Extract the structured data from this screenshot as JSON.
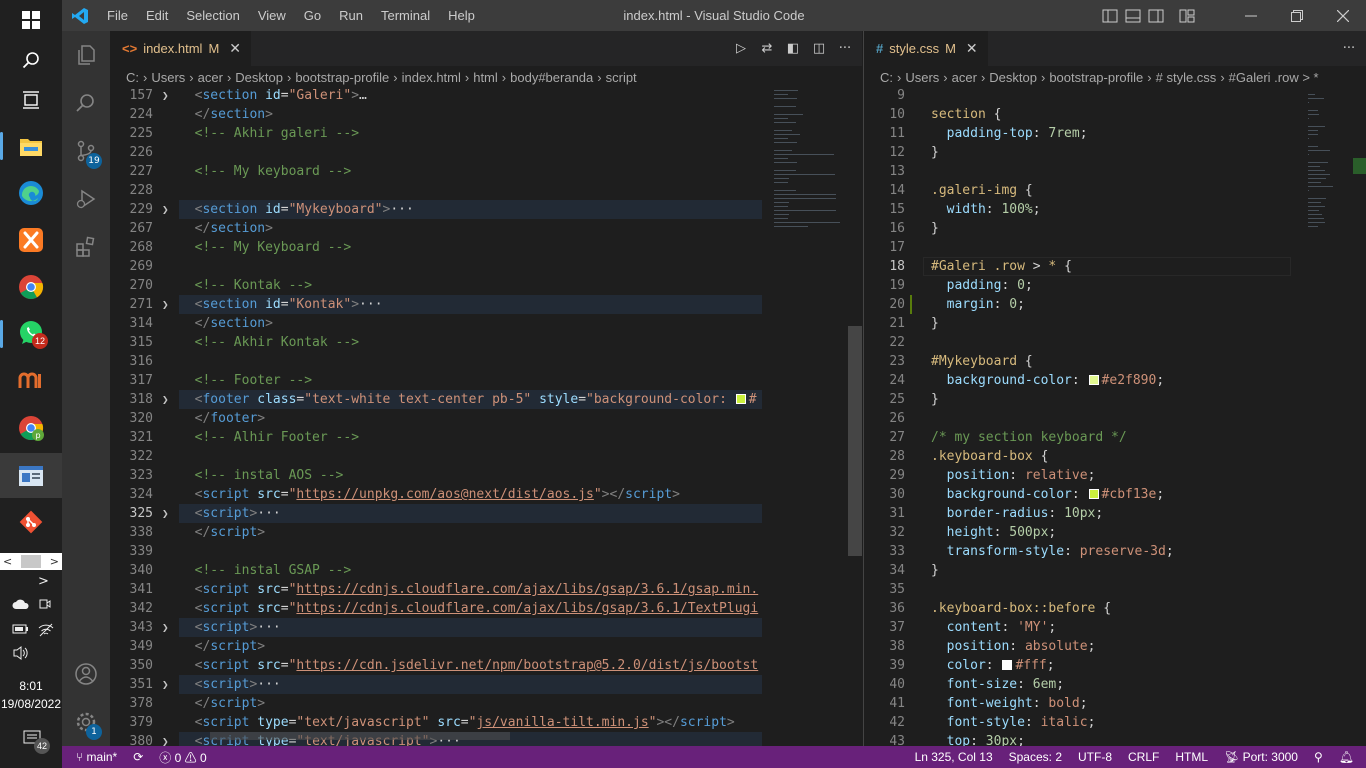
{
  "taskbar": {
    "apps": [
      {
        "name": "windows-start-icon"
      },
      {
        "name": "search-icon"
      },
      {
        "name": "task-view-icon"
      },
      {
        "name": "file-explorer-icon"
      },
      {
        "name": "edge-icon"
      },
      {
        "name": "xampp-icon"
      },
      {
        "name": "chrome-icon"
      },
      {
        "name": "whatsapp-icon",
        "badge": "12"
      },
      {
        "name": "mendeley-icon"
      },
      {
        "name": "chrome-profile-icon"
      },
      {
        "name": "vscode-taskbar-icon"
      },
      {
        "name": "git-icon"
      }
    ],
    "time": "8:01",
    "date": "19/08/2022",
    "notification_count": "42"
  },
  "titlebar": {
    "menu": [
      "File",
      "Edit",
      "Selection",
      "View",
      "Go",
      "Run",
      "Terminal",
      "Help"
    ],
    "title": "index.html - Visual Studio Code"
  },
  "activity": {
    "source_control_badge": "19",
    "settings_badge": "1"
  },
  "editor_left": {
    "tab": {
      "icon": "<>",
      "label": "index.html",
      "modified": "M"
    },
    "breadcrumb": [
      "C:",
      "Users",
      "acer",
      "Desktop",
      "bootstrap-profile",
      "index.html",
      "html",
      "body#beranda",
      "script"
    ],
    "lines": [
      {
        "n": "157",
        "fold": true,
        "html": "  <span class='c-brk'>&lt;</span><span class='c-tag'>section</span> <span class='c-att'>id</span>=<span class='c-str'>\"Galeri\"</span><span class='c-brk'>&gt;</span>…"
      },
      {
        "n": "224",
        "html": "  <span class='c-brk'>&lt;/</span><span class='c-tag'>section</span><span class='c-brk'>&gt;</span>"
      },
      {
        "n": "225",
        "html": "  <span class='c-cmt'>&lt;!-- Akhir galeri --&gt;</span>"
      },
      {
        "n": "226",
        "html": ""
      },
      {
        "n": "227",
        "html": "  <span class='c-cmt'>&lt;!-- My keyboard --&gt;</span>"
      },
      {
        "n": "228",
        "html": ""
      },
      {
        "n": "229",
        "fold": true,
        "hl": true,
        "html": "  <span class='c-brk'>&lt;</span><span class='c-tag'>section</span> <span class='c-att'>id</span>=<span class='c-str'>\"Mykeyboard\"</span><span class='c-brk'>&gt;</span><span class='c-pun'>···</span>"
      },
      {
        "n": "267",
        "html": "  <span class='c-brk'>&lt;/</span><span class='c-tag'>section</span><span class='c-brk'>&gt;</span>"
      },
      {
        "n": "268",
        "html": "  <span class='c-cmt'>&lt;!-- My Keyboard --&gt;</span>"
      },
      {
        "n": "269",
        "html": ""
      },
      {
        "n": "270",
        "html": "  <span class='c-cmt'>&lt;!-- Kontak --&gt;</span>"
      },
      {
        "n": "271",
        "fold": true,
        "hl": true,
        "html": "  <span class='c-brk'>&lt;</span><span class='c-tag'>section</span> <span class='c-att'>id</span>=<span class='c-str'>\"Kontak\"</span><span class='c-brk'>&gt;</span><span class='c-pun'>···</span>"
      },
      {
        "n": "314",
        "html": "  <span class='c-brk'>&lt;/</span><span class='c-tag'>section</span><span class='c-brk'>&gt;</span>"
      },
      {
        "n": "315",
        "html": "  <span class='c-cmt'>&lt;!-- Akhir Kontak --&gt;</span>"
      },
      {
        "n": "316",
        "html": ""
      },
      {
        "n": "317",
        "html": "  <span class='c-cmt'>&lt;!-- Footer --&gt;</span>"
      },
      {
        "n": "318",
        "fold": true,
        "hl": true,
        "html": "  <span class='c-brk'>&lt;</span><span class='c-tag'>footer</span> <span class='c-att'>class</span>=<span class='c-str'>\"text-white text-center pb-5\"</span> <span class='c-att'>style</span>=<span class='c-str'>\"background-color: </span><span class='swatch' style='background:#cbf13e'></span><span class='c-str'>#</span>"
      },
      {
        "n": "320",
        "html": "  <span class='c-brk'>&lt;/</span><span class='c-tag'>footer</span><span class='c-brk'>&gt;</span>"
      },
      {
        "n": "321",
        "html": "  <span class='c-cmt'>&lt;!-- Alhir Footer --&gt;</span>"
      },
      {
        "n": "322",
        "html": ""
      },
      {
        "n": "323",
        "html": "  <span class='c-cmt'>&lt;!-- instal AOS --&gt;</span>"
      },
      {
        "n": "324",
        "html": "  <span class='c-brk'>&lt;</span><span class='c-tag'>script</span> <span class='c-att'>src</span>=<span class='c-str'>\"<u>https://unpkg.com/aos@next/dist/aos.js</u>\"</span><span class='c-brk'>&gt;&lt;/</span><span class='c-tag'>script</span><span class='c-brk'>&gt;</span>"
      },
      {
        "n": "325",
        "fold": true,
        "hl": true,
        "cur": true,
        "html": "  <span class='c-brk'>&lt;</span><span class='c-tag'>script</span><span class='c-brk'>&gt;</span><span class='c-pun'>···</span>"
      },
      {
        "n": "338",
        "html": "  <span class='c-brk'>&lt;/</span><span class='c-tag'>script</span><span class='c-brk'>&gt;</span>"
      },
      {
        "n": "339",
        "html": ""
      },
      {
        "n": "340",
        "html": "  <span class='c-cmt'>&lt;!-- instal GSAP --&gt;</span>"
      },
      {
        "n": "341",
        "html": "  <span class='c-brk'>&lt;</span><span class='c-tag'>script</span> <span class='c-att'>src</span>=<span class='c-str'>\"<u>https://cdnjs.cloudflare.com/ajax/libs/gsap/3.6.1/gsap.min.</u></span>"
      },
      {
        "n": "342",
        "html": "  <span class='c-brk'>&lt;</span><span class='c-tag'>script</span> <span class='c-att'>src</span>=<span class='c-str'>\"<u>https://cdnjs.cloudflare.com/ajax/libs/gsap/3.6.1/TextPlugi</u></span>"
      },
      {
        "n": "343",
        "fold": true,
        "hl": true,
        "html": "  <span class='c-brk'>&lt;</span><span class='c-tag'>script</span><span class='c-brk'>&gt;</span><span class='c-pun'>···</span>"
      },
      {
        "n": "349",
        "html": "  <span class='c-brk'>&lt;/</span><span class='c-tag'>script</span><span class='c-brk'>&gt;</span>"
      },
      {
        "n": "350",
        "html": "  <span class='c-brk'>&lt;</span><span class='c-tag'>script</span> <span class='c-att'>src</span>=<span class='c-str'>\"<u>https://cdn.jsdelivr.net/npm/bootstrap@5.2.0/dist/js/bootst</u></span>"
      },
      {
        "n": "351",
        "fold": true,
        "hl": true,
        "html": "  <span class='c-brk'>&lt;</span><span class='c-tag'>script</span><span class='c-brk'>&gt;</span><span class='c-pun'>···</span>"
      },
      {
        "n": "378",
        "html": "  <span class='c-brk'>&lt;/</span><span class='c-tag'>script</span><span class='c-brk'>&gt;</span>"
      },
      {
        "n": "379",
        "html": "  <span class='c-brk'>&lt;</span><span class='c-tag'>script</span> <span class='c-att'>type</span>=<span class='c-str'>\"text/javascript\"</span> <span class='c-att'>src</span>=<span class='c-str'>\"<u>js/vanilla-tilt.min.js</u>\"</span><span class='c-brk'>&gt;&lt;/</span><span class='c-tag'>script</span><span class='c-brk'>&gt;</span>"
      },
      {
        "n": "380",
        "fold": true,
        "hl": true,
        "html": "  <span class='c-brk'>&lt;</span><span class='c-tag'>script</span> <span class='c-att'>type</span>=<span class='c-str'>\"text/javascript\"</span><span class='c-brk'>&gt;</span><span class='c-pun'>···</span>"
      }
    ]
  },
  "editor_right": {
    "tab": {
      "icon": "#",
      "label": "style.css",
      "modified": "M"
    },
    "breadcrumb": [
      "C:",
      "Users",
      "acer",
      "Desktop",
      "bootstrap-profile",
      "# style.css",
      "#Galeri .row > *"
    ],
    "lines": [
      {
        "n": "9",
        "html": ""
      },
      {
        "n": "10",
        "html": "<span class='c-sel'>section</span> <span class='c-pun'>{</span>"
      },
      {
        "n": "11",
        "html": "  <span class='c-prop'>padding-top</span>: <span class='c-num'>7rem</span>;"
      },
      {
        "n": "12",
        "html": "<span class='c-pun'>}</span>"
      },
      {
        "n": "13",
        "html": ""
      },
      {
        "n": "14",
        "html": "<span class='c-sel'>.galeri-img</span> <span class='c-pun'>{</span>"
      },
      {
        "n": "15",
        "html": "  <span class='c-prop'>width</span>: <span class='c-num'>100%</span>;"
      },
      {
        "n": "16",
        "html": "<span class='c-pun'>}</span>"
      },
      {
        "n": "17",
        "html": ""
      },
      {
        "n": "18",
        "cur": true,
        "html": "<span class='c-sel'>#Galeri .row</span> <span class='c-pun'>&gt;</span> <span class='c-sel'>*</span> <span class='c-pun'>{</span>"
      },
      {
        "n": "19",
        "html": "  <span class='c-prop'>padding</span>: <span class='c-num'>0</span>;"
      },
      {
        "n": "20",
        "mod": true,
        "html": "  <span class='c-prop'>margin</span>: <span class='c-num'>0</span>;"
      },
      {
        "n": "21",
        "html": "<span class='c-pun'>}</span>"
      },
      {
        "n": "22",
        "html": ""
      },
      {
        "n": "23",
        "html": "<span class='c-sel'>#Mykeyboard</span> <span class='c-pun'>{</span>"
      },
      {
        "n": "24",
        "html": "  <span class='c-prop'>background-color</span>: <span class='swatch' style='background:#e2f890'></span><span class='c-val'>#e2f890</span>;"
      },
      {
        "n": "25",
        "html": "<span class='c-pun'>}</span>"
      },
      {
        "n": "26",
        "html": ""
      },
      {
        "n": "27",
        "html": "<span class='c-cmt'>/* my section keyboard */</span>"
      },
      {
        "n": "28",
        "html": "<span class='c-sel'>.keyboard-box</span> <span class='c-pun'>{</span>"
      },
      {
        "n": "29",
        "html": "  <span class='c-prop'>position</span>: <span class='c-val'>relative</span>;"
      },
      {
        "n": "30",
        "html": "  <span class='c-prop'>background-color</span>: <span class='swatch' style='background:#cbf13e'></span><span class='c-val'>#cbf13e</span>;"
      },
      {
        "n": "31",
        "html": "  <span class='c-prop'>border-radius</span>: <span class='c-num'>10px</span>;"
      },
      {
        "n": "32",
        "html": "  <span class='c-prop'>height</span>: <span class='c-num'>500px</span>;"
      },
      {
        "n": "33",
        "html": "  <span class='c-prop'>transform-style</span>: <span class='c-val'>preserve-3d</span>;"
      },
      {
        "n": "34",
        "html": "<span class='c-pun'>}</span>"
      },
      {
        "n": "35",
        "html": ""
      },
      {
        "n": "36",
        "html": "<span class='c-sel'>.keyboard-box::before</span> <span class='c-pun'>{</span>"
      },
      {
        "n": "37",
        "html": "  <span class='c-prop'>content</span>: <span class='c-val'>'MY'</span>;"
      },
      {
        "n": "38",
        "html": "  <span class='c-prop'>position</span>: <span class='c-val'>absolute</span>;"
      },
      {
        "n": "39",
        "html": "  <span class='c-prop'>color</span>: <span class='swatch' style='background:#ffffff'></span><span class='c-val'>#fff</span>;"
      },
      {
        "n": "40",
        "html": "  <span class='c-prop'>font-size</span>: <span class='c-num'>6em</span>;"
      },
      {
        "n": "41",
        "html": "  <span class='c-prop'>font-weight</span>: <span class='c-val'>bold</span>;"
      },
      {
        "n": "42",
        "html": "  <span class='c-prop'>font-style</span>: <span class='c-val'>italic</span>;"
      },
      {
        "n": "43",
        "html": "  <span class='c-prop'>top</span>: <span class='c-num'>30px</span>;"
      }
    ]
  },
  "status": {
    "branch": "main*",
    "sync": "⟳",
    "errors": "0",
    "warnings": "0",
    "position": "Ln 325, Col 13",
    "spaces": "Spaces: 2",
    "encoding": "UTF-8",
    "eol": "CRLF",
    "language": "HTML",
    "port": "Port: 3000"
  },
  "colors": {
    "status_bar": "#68217a",
    "title_bar": "#3c3c3c",
    "activity_bar": "#333333",
    "editor": "#1e1e1e"
  }
}
